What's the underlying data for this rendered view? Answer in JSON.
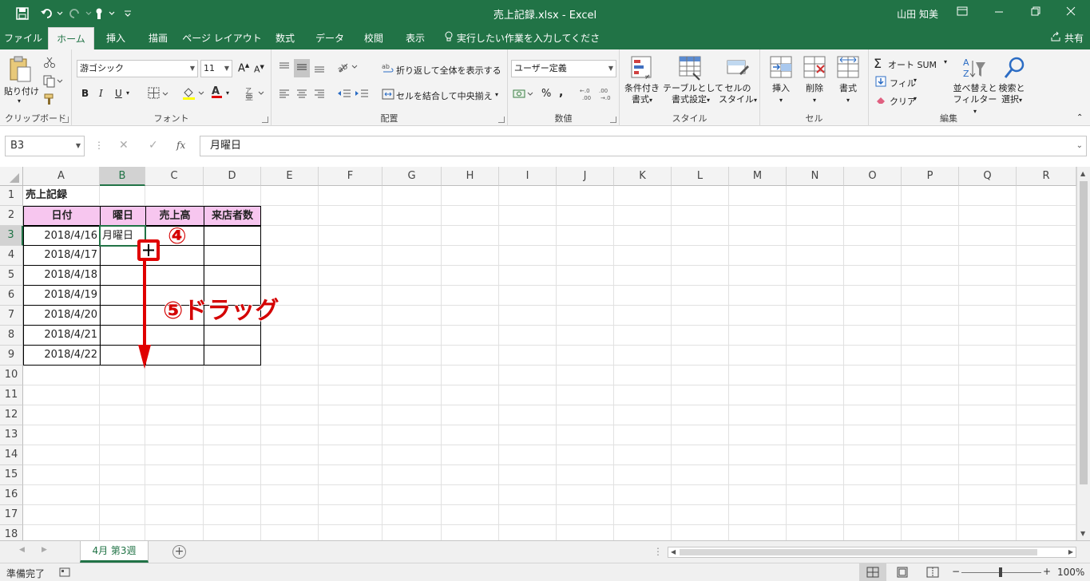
{
  "window": {
    "title": "売上記録.xlsx  -  Excel",
    "user": "山田 知美"
  },
  "tabs": [
    "ファイル",
    "ホーム",
    "挿入",
    "描画",
    "ページ レイアウト",
    "数式",
    "データ",
    "校閲",
    "表示"
  ],
  "tell_me": "実行したい作業を入力してください",
  "share": "共有",
  "ribbon": {
    "clipboard": {
      "paste": "貼り付け",
      "label": "クリップボード"
    },
    "font": {
      "name": "游ゴシック",
      "size": "11",
      "bold": "B",
      "italic": "I",
      "underline": "U",
      "font_color_glyph": "A",
      "label": "フォント"
    },
    "alignment": {
      "wrap": "折り返して全体を表示する",
      "merge": "セルを結合して中央揃え",
      "label": "配置"
    },
    "number": {
      "format": "ユーザー定義",
      "percent": "%",
      "comma": ",",
      "label": "数値"
    },
    "styles": {
      "conditional": "条件付き\n書式",
      "table": "テーブルとして\n書式設定",
      "cell_styles": "セルの\nスタイル",
      "label": "スタイル"
    },
    "cells": {
      "insert": "挿入",
      "delete": "削除",
      "format": "書式",
      "label": "セル"
    },
    "editing": {
      "autosum": "オート SUM",
      "fill": "フィル",
      "clear": "クリア",
      "sort": "並べ替えと\nフィルター",
      "find": "検索と\n選択",
      "label": "編集"
    }
  },
  "formula_bar": {
    "name_box": "B3",
    "cancel": "✕",
    "enter": "✓",
    "fx": "fx",
    "value": "月曜日"
  },
  "columns": [
    "A",
    "B",
    "C",
    "D",
    "E",
    "F",
    "G",
    "H",
    "I",
    "J",
    "K",
    "L",
    "M",
    "N",
    "O",
    "P",
    "Q",
    "R"
  ],
  "rows": [
    "1",
    "2",
    "3",
    "4",
    "5",
    "6",
    "7",
    "8",
    "9",
    "10",
    "11",
    "12",
    "13",
    "14",
    "15",
    "16",
    "17",
    "18"
  ],
  "sheet": {
    "title": "売上記録",
    "headers": [
      "日付",
      "曜日",
      "売上高",
      "来店者数"
    ],
    "dates": [
      "2018/4/16",
      "2018/4/17",
      "2018/4/18",
      "2018/4/19",
      "2018/4/20",
      "2018/4/21",
      "2018/4/22"
    ],
    "b3": "月曜日"
  },
  "annotations": {
    "step4": "④",
    "step5": "⑤ドラッグ"
  },
  "sheet_tab": "4月 第3週",
  "status": {
    "ready": "準備完了",
    "zoom": "100%"
  },
  "colors": {
    "excel_green": "#217346",
    "header_fill": "#f7c6ef",
    "annotation_red": "#e00000"
  }
}
